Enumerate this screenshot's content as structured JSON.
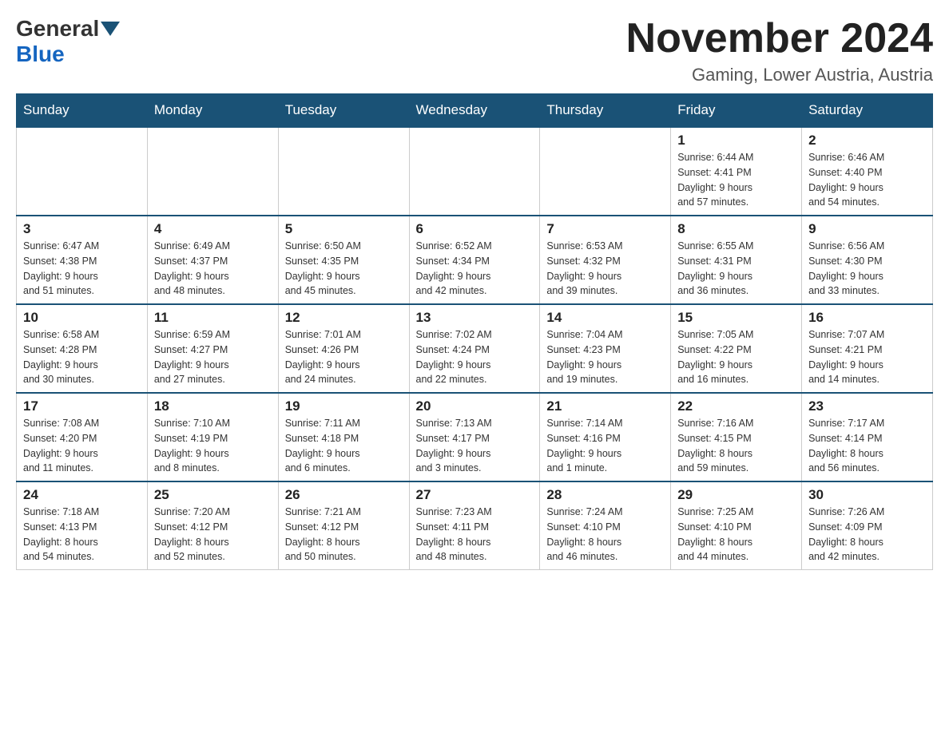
{
  "header": {
    "logo_general": "General",
    "logo_blue": "Blue",
    "month_title": "November 2024",
    "location": "Gaming, Lower Austria, Austria"
  },
  "weekdays": [
    "Sunday",
    "Monday",
    "Tuesday",
    "Wednesday",
    "Thursday",
    "Friday",
    "Saturday"
  ],
  "weeks": [
    [
      {
        "day": "",
        "info": ""
      },
      {
        "day": "",
        "info": ""
      },
      {
        "day": "",
        "info": ""
      },
      {
        "day": "",
        "info": ""
      },
      {
        "day": "",
        "info": ""
      },
      {
        "day": "1",
        "info": "Sunrise: 6:44 AM\nSunset: 4:41 PM\nDaylight: 9 hours\nand 57 minutes."
      },
      {
        "day": "2",
        "info": "Sunrise: 6:46 AM\nSunset: 4:40 PM\nDaylight: 9 hours\nand 54 minutes."
      }
    ],
    [
      {
        "day": "3",
        "info": "Sunrise: 6:47 AM\nSunset: 4:38 PM\nDaylight: 9 hours\nand 51 minutes."
      },
      {
        "day": "4",
        "info": "Sunrise: 6:49 AM\nSunset: 4:37 PM\nDaylight: 9 hours\nand 48 minutes."
      },
      {
        "day": "5",
        "info": "Sunrise: 6:50 AM\nSunset: 4:35 PM\nDaylight: 9 hours\nand 45 minutes."
      },
      {
        "day": "6",
        "info": "Sunrise: 6:52 AM\nSunset: 4:34 PM\nDaylight: 9 hours\nand 42 minutes."
      },
      {
        "day": "7",
        "info": "Sunrise: 6:53 AM\nSunset: 4:32 PM\nDaylight: 9 hours\nand 39 minutes."
      },
      {
        "day": "8",
        "info": "Sunrise: 6:55 AM\nSunset: 4:31 PM\nDaylight: 9 hours\nand 36 minutes."
      },
      {
        "day": "9",
        "info": "Sunrise: 6:56 AM\nSunset: 4:30 PM\nDaylight: 9 hours\nand 33 minutes."
      }
    ],
    [
      {
        "day": "10",
        "info": "Sunrise: 6:58 AM\nSunset: 4:28 PM\nDaylight: 9 hours\nand 30 minutes."
      },
      {
        "day": "11",
        "info": "Sunrise: 6:59 AM\nSunset: 4:27 PM\nDaylight: 9 hours\nand 27 minutes."
      },
      {
        "day": "12",
        "info": "Sunrise: 7:01 AM\nSunset: 4:26 PM\nDaylight: 9 hours\nand 24 minutes."
      },
      {
        "day": "13",
        "info": "Sunrise: 7:02 AM\nSunset: 4:24 PM\nDaylight: 9 hours\nand 22 minutes."
      },
      {
        "day": "14",
        "info": "Sunrise: 7:04 AM\nSunset: 4:23 PM\nDaylight: 9 hours\nand 19 minutes."
      },
      {
        "day": "15",
        "info": "Sunrise: 7:05 AM\nSunset: 4:22 PM\nDaylight: 9 hours\nand 16 minutes."
      },
      {
        "day": "16",
        "info": "Sunrise: 7:07 AM\nSunset: 4:21 PM\nDaylight: 9 hours\nand 14 minutes."
      }
    ],
    [
      {
        "day": "17",
        "info": "Sunrise: 7:08 AM\nSunset: 4:20 PM\nDaylight: 9 hours\nand 11 minutes."
      },
      {
        "day": "18",
        "info": "Sunrise: 7:10 AM\nSunset: 4:19 PM\nDaylight: 9 hours\nand 8 minutes."
      },
      {
        "day": "19",
        "info": "Sunrise: 7:11 AM\nSunset: 4:18 PM\nDaylight: 9 hours\nand 6 minutes."
      },
      {
        "day": "20",
        "info": "Sunrise: 7:13 AM\nSunset: 4:17 PM\nDaylight: 9 hours\nand 3 minutes."
      },
      {
        "day": "21",
        "info": "Sunrise: 7:14 AM\nSunset: 4:16 PM\nDaylight: 9 hours\nand 1 minute."
      },
      {
        "day": "22",
        "info": "Sunrise: 7:16 AM\nSunset: 4:15 PM\nDaylight: 8 hours\nand 59 minutes."
      },
      {
        "day": "23",
        "info": "Sunrise: 7:17 AM\nSunset: 4:14 PM\nDaylight: 8 hours\nand 56 minutes."
      }
    ],
    [
      {
        "day": "24",
        "info": "Sunrise: 7:18 AM\nSunset: 4:13 PM\nDaylight: 8 hours\nand 54 minutes."
      },
      {
        "day": "25",
        "info": "Sunrise: 7:20 AM\nSunset: 4:12 PM\nDaylight: 8 hours\nand 52 minutes."
      },
      {
        "day": "26",
        "info": "Sunrise: 7:21 AM\nSunset: 4:12 PM\nDaylight: 8 hours\nand 50 minutes."
      },
      {
        "day": "27",
        "info": "Sunrise: 7:23 AM\nSunset: 4:11 PM\nDaylight: 8 hours\nand 48 minutes."
      },
      {
        "day": "28",
        "info": "Sunrise: 7:24 AM\nSunset: 4:10 PM\nDaylight: 8 hours\nand 46 minutes."
      },
      {
        "day": "29",
        "info": "Sunrise: 7:25 AM\nSunset: 4:10 PM\nDaylight: 8 hours\nand 44 minutes."
      },
      {
        "day": "30",
        "info": "Sunrise: 7:26 AM\nSunset: 4:09 PM\nDaylight: 8 hours\nand 42 minutes."
      }
    ]
  ]
}
